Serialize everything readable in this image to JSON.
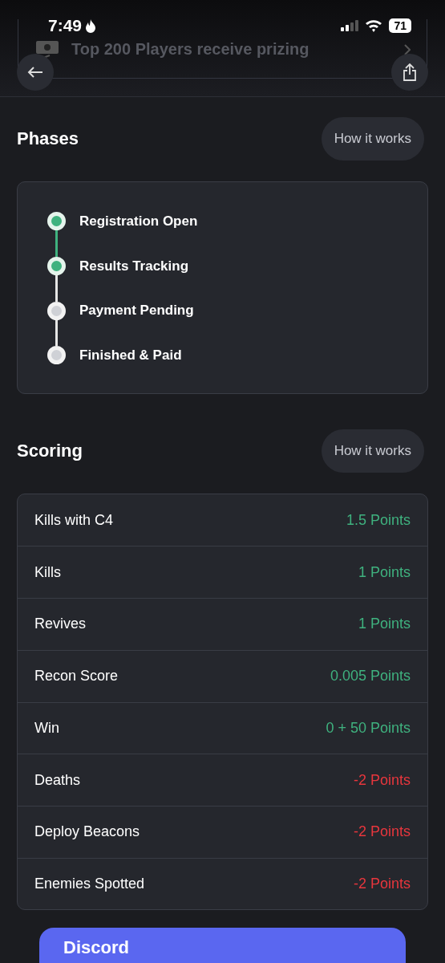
{
  "status_bar": {
    "time": "7:49",
    "battery": "71"
  },
  "banner": {
    "text": "Top 200 Players receive prizing"
  },
  "phases": {
    "title": "Phases",
    "help_button": "How it works",
    "steps": [
      {
        "label": "Registration Open",
        "done": true
      },
      {
        "label": "Results Tracking",
        "done": true
      },
      {
        "label": "Payment Pending",
        "done": false
      },
      {
        "label": "Finished & Paid",
        "done": false
      }
    ]
  },
  "scoring": {
    "title": "Scoring",
    "help_button": "How it works",
    "rows": [
      {
        "label": "Kills with C4",
        "points": "1.5 Points",
        "color": "#3fb27f"
      },
      {
        "label": "Kills",
        "points": "1 Points",
        "color": "#3fb27f"
      },
      {
        "label": "Revives",
        "points": "1 Points",
        "color": "#3fb27f"
      },
      {
        "label": "Recon Score",
        "points": "0.005 Points",
        "color": "#3fb27f"
      },
      {
        "label": "Win",
        "points": "0 + 50 Points",
        "color": "#3fb27f"
      },
      {
        "label": "Deaths",
        "points": "-2 Points",
        "color": "#e8363d"
      },
      {
        "label": "Deploy Beacons",
        "points": "-2 Points",
        "color": "#e8363d"
      },
      {
        "label": "Enemies Spotted",
        "points": "-2 Points",
        "color": "#e8363d"
      }
    ]
  },
  "promo": {
    "title": "Discord"
  }
}
